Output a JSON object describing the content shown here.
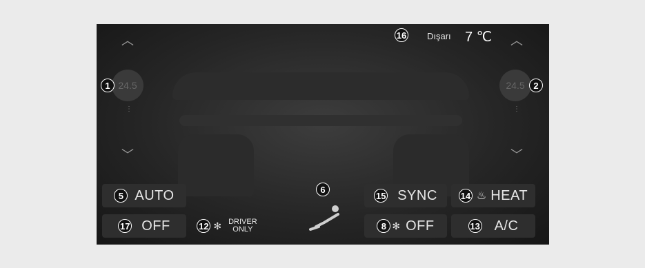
{
  "outside": {
    "label": "Dışarı",
    "value": "7 ℃"
  },
  "left_temp": {
    "value": "24.5"
  },
  "right_temp": {
    "value": "24.5"
  },
  "buttons": {
    "auto": "AUTO",
    "off_left": "OFF",
    "driver_only_line1": "DRIVER",
    "driver_only_line2": "ONLY",
    "sync": "SYNC",
    "heat": "HEAT",
    "fan_off": "OFF",
    "ac": "A/C"
  },
  "callouts": {
    "c1": "1",
    "c2": "2",
    "c5": "5",
    "c6": "6",
    "c8": "8",
    "c12": "12",
    "c13": "13",
    "c14": "14",
    "c15": "15",
    "c16": "16",
    "c17": "17"
  },
  "icons": {
    "chevron_up": "︿",
    "chevron_down": "﹀",
    "fan": "✻",
    "heat": "♨",
    "dots": "⋮"
  },
  "colors": {
    "screen": "#262626",
    "text": "#e6e6e6",
    "page_bg": "#ebebeb"
  }
}
